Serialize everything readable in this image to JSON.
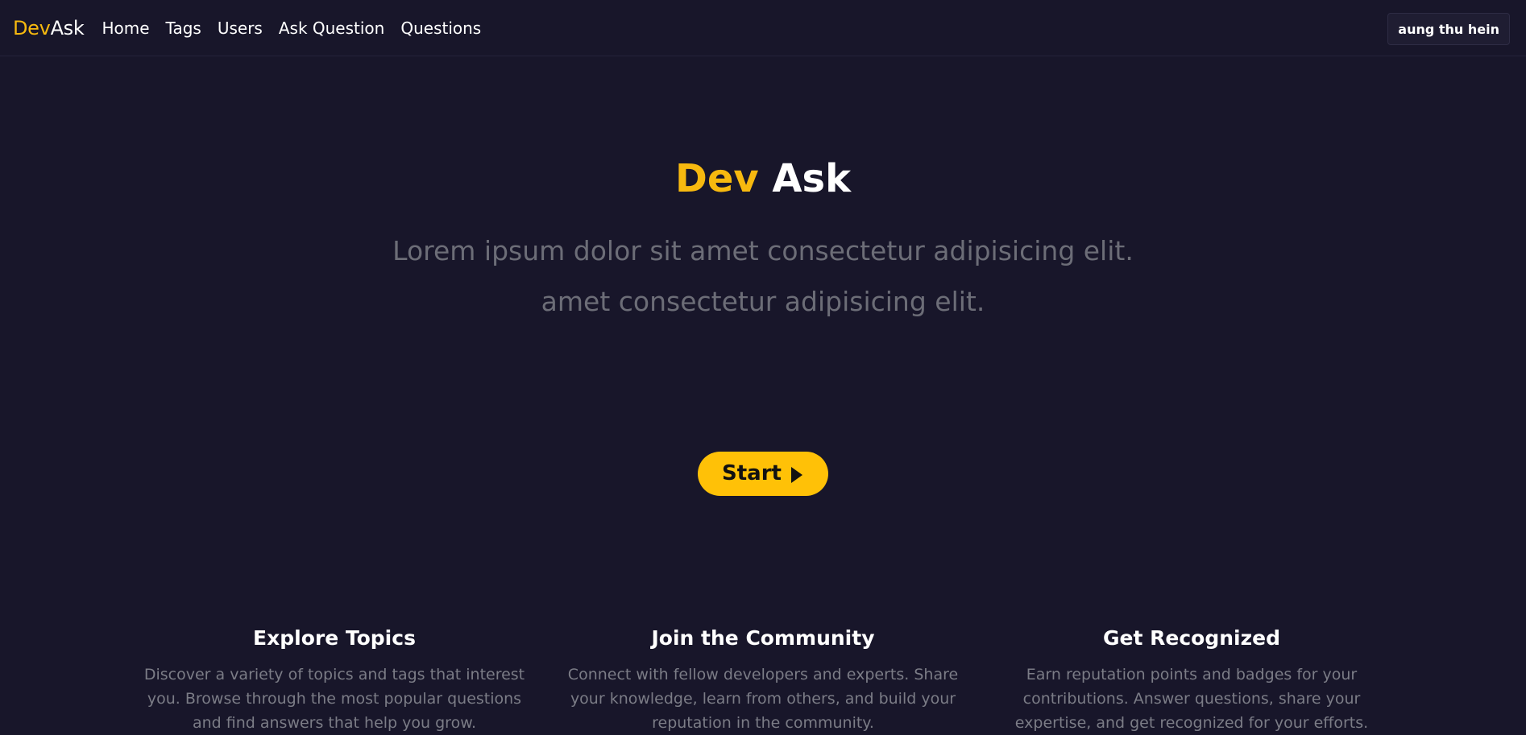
{
  "nav": {
    "brand_dev": "Dev",
    "brand_ask": "Ask",
    "links": [
      "Home",
      "Tags",
      "Users",
      "Ask Question",
      "Questions"
    ],
    "user": "aung thu hein"
  },
  "hero": {
    "title_dev": "Dev",
    "title_ask": "Ask",
    "lead_line1": "Lorem ipsum dolor sit amet consectetur adipisicing elit.",
    "lead_line2": "amet consectetur adipisicing elit.",
    "start_label": "Start"
  },
  "features": [
    {
      "title": "Explore Topics",
      "text": "Discover a variety of topics and tags that interest you. Browse through the most popular questions and find answers that help you grow."
    },
    {
      "title": "Join the Community",
      "text": "Connect with fellow developers and experts. Share your knowledge, learn from others, and build your reputation in the community."
    },
    {
      "title": "Get Recognized",
      "text": "Earn reputation points and badges for your contributions. Answer questions, share your expertise, and get recognized for your efforts."
    }
  ],
  "colors": {
    "background": "#18162a",
    "accent": "#ffc107",
    "brand_yellow": "#f7b90f",
    "muted_text": "#6c6d77"
  },
  "icons": {
    "start_arrow": "caret-right-icon"
  }
}
